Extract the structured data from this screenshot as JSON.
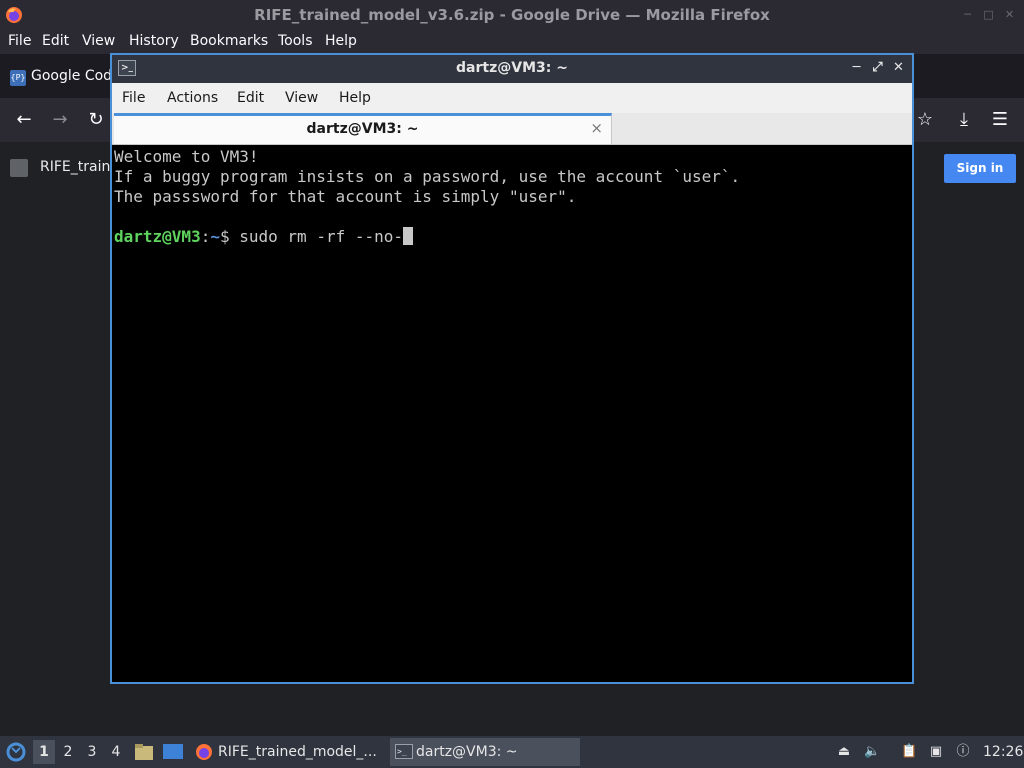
{
  "firefox": {
    "title": "RIFE_trained_model_v3.6.zip - Google Drive — Mozilla Firefox",
    "menu": [
      "File",
      "Edit",
      "View",
      "History",
      "Bookmarks",
      "Tools",
      "Help"
    ],
    "tab_label": "Google Code",
    "drive_file_label": "RIFE_traine",
    "signin_label": "Sign in"
  },
  "terminal": {
    "title": "dartz@VM3: ~",
    "menu": [
      "File",
      "Actions",
      "Edit",
      "View",
      "Help"
    ],
    "tab_label": "dartz@VM3: ~",
    "tab_close": "×",
    "lines": [
      "Welcome to VM3!",
      "If a buggy program insists on a password, use the account `user`.",
      "The passsword for that account is simply \"user\".",
      ""
    ],
    "prompt_user": "dartz@VM3",
    "prompt_sep": ":",
    "prompt_path": "~",
    "prompt_symbol": "$ ",
    "command": "sudo rm -rf --no-"
  },
  "taskbar": {
    "workspaces": [
      "1",
      "2",
      "3",
      "4"
    ],
    "active_workspace": "1",
    "tasks": [
      {
        "label": "RIFE_trained_model_...",
        "icon": "firefox-icon"
      },
      {
        "label": "dartz@VM3: ~",
        "icon": "terminal-icon"
      }
    ],
    "clock": "12:26"
  },
  "colors": {
    "accent": "#4a90d9",
    "prompt_user": "#5ed35e",
    "prompt_path": "#5a8ed8",
    "signin": "#4688f1"
  }
}
